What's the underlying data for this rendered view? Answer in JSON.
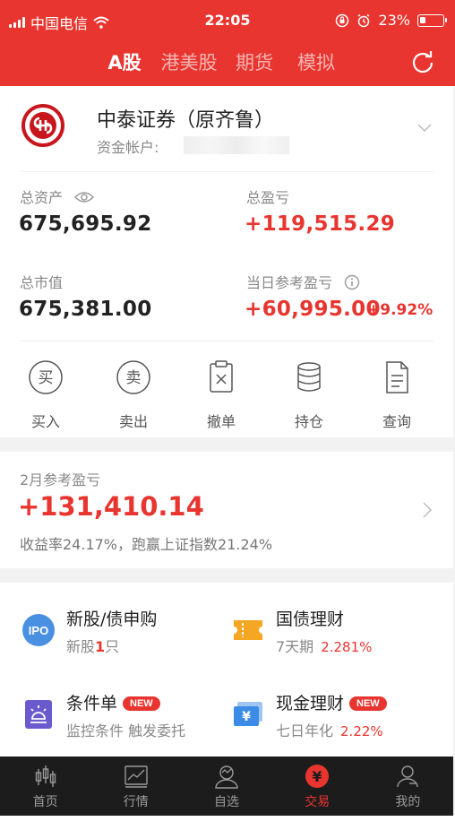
{
  "status_bar": {
    "carrier": "中国电信",
    "time": "22:05",
    "battery": "23%"
  },
  "nav": {
    "tabs": [
      {
        "label": "A股",
        "active": true
      },
      {
        "label": "港美股"
      },
      {
        "label": "期货"
      },
      {
        "label": "模拟"
      }
    ]
  },
  "account": {
    "broker_name": "中泰证券（原齐鲁）",
    "account_label": "资金帐户:",
    "total_assets_label": "总资产",
    "total_assets": "675,695.92",
    "total_pl_label": "总盈亏",
    "total_pl": "+119,515.29",
    "market_value_label": "总市值",
    "market_value": "675,381.00",
    "daily_pl_label": "当日参考盈亏",
    "daily_pl": "+60,995.00",
    "daily_pl_pct": "+9.92%"
  },
  "actions": [
    {
      "label": "买入",
      "glyph": "买"
    },
    {
      "label": "卖出",
      "glyph": "卖"
    },
    {
      "label": "撤单"
    },
    {
      "label": "持仓"
    },
    {
      "label": "查询"
    }
  ],
  "monthly": {
    "label": "2月参考盈亏",
    "value": "+131,410.14",
    "summary": "收益率24.17%，跑赢上证指数21.24%"
  },
  "services": {
    "ipo": {
      "title": "新股/债申购",
      "icon_text": "IPO",
      "sub_prefix": "新股",
      "count": "1",
      "sub_suffix": "只"
    },
    "bond": {
      "title": "国债理财",
      "sub": "7天期",
      "rate": "2.281%"
    },
    "conditional": {
      "title": "条件单",
      "badge": "NEW",
      "sub": "监控条件 触发委托"
    },
    "cash": {
      "title": "现金理财",
      "badge": "NEW",
      "sub": "七日年化",
      "rate": "2.22%",
      "icon_text": "¥"
    }
  },
  "tab_bar": [
    {
      "label": "首页"
    },
    {
      "label": "行情"
    },
    {
      "label": "自选"
    },
    {
      "label": "交易",
      "active": true,
      "icon_text": "¥"
    },
    {
      "label": "我的"
    }
  ],
  "colors": {
    "brand_red": "#e8352f",
    "tab_bar_bg": "#1c1c1c"
  }
}
